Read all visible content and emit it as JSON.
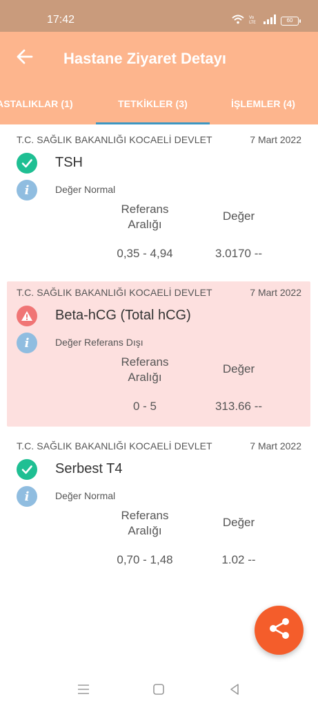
{
  "status_bar": {
    "time": "17:42",
    "battery": "60",
    "icons": [
      "wifi-icon",
      "volte-icon",
      "signal-icon",
      "battery-icon"
    ]
  },
  "app_bar": {
    "title": "Hastane Ziyaret Detayı",
    "back_icon": "arrow-left-icon"
  },
  "tabs": [
    {
      "label": "ASTALIKLAR (1)",
      "selected": false
    },
    {
      "label": "TETKİKLER (3)",
      "selected": true
    },
    {
      "label": "İŞLEMLER (4)",
      "selected": false
    }
  ],
  "tests": [
    {
      "hospital": "T.C. SAĞLIK BAKANLIĞI KOCAELİ DEVLET",
      "date": "7 Mart 2022",
      "name": "TSH",
      "status": "normal",
      "result_text": "Değer Normal",
      "ref_header": "Referans Aralığı",
      "val_header": "Değer",
      "ref_range": "0,35 - 4,94",
      "value": "3.0170 --"
    },
    {
      "hospital": "T.C. SAĞLIK BAKANLIĞI KOCAELİ DEVLET",
      "date": "7 Mart 2022",
      "name": "Beta-hCG (Total hCG)",
      "status": "abnormal",
      "result_text": "Değer Referans Dışı",
      "ref_header": "Referans Aralığı",
      "val_header": "Değer",
      "ref_range": "0 - 5",
      "value": "313.66 --"
    },
    {
      "hospital": "T.C. SAĞLIK BAKANLIĞI KOCAELİ DEVLET",
      "date": "7 Mart 2022",
      "name": "Serbest T4",
      "status": "normal",
      "result_text": "Değer Normal",
      "ref_header": "Referans Aralığı",
      "val_header": "Değer",
      "ref_range": "0,70 - 1,48",
      "value": "1.02 --"
    }
  ],
  "colors": {
    "header": "#fdb58d",
    "status_bar": "#c99b7c",
    "tab_indicator": "#3d97c2",
    "ok": "#1fbf93",
    "warn": "#f07575",
    "alert_bg": "#fde0df",
    "info": "#90bde0",
    "fab": "#f45d2b"
  },
  "fab": {
    "icon": "share-icon"
  },
  "nav_bar": {
    "icons": [
      "menu-icon",
      "home-icon",
      "back-icon"
    ]
  }
}
